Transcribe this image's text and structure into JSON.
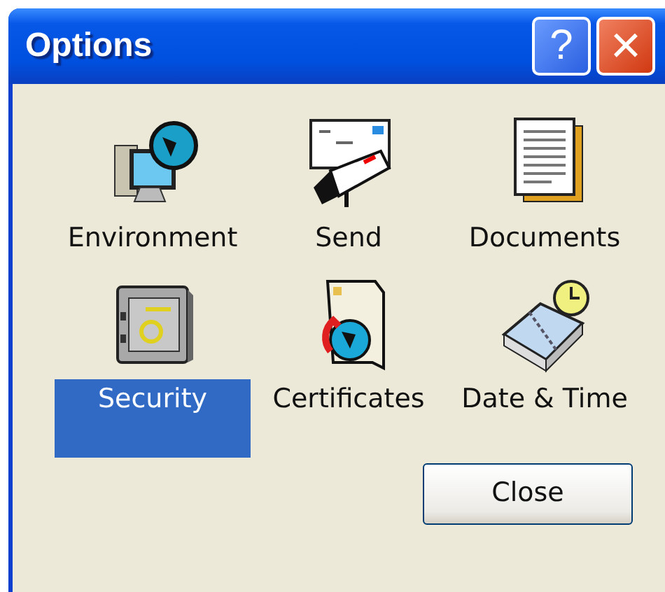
{
  "window": {
    "title": "Options",
    "help_button": "?",
    "close_button": "×"
  },
  "items": [
    {
      "kind": "environment",
      "label": "Environment",
      "selected": false
    },
    {
      "kind": "send",
      "label": "Send",
      "selected": false
    },
    {
      "kind": "documents",
      "label": "Documents",
      "selected": false
    },
    {
      "kind": "security",
      "label": "Security",
      "selected": true
    },
    {
      "kind": "certificates",
      "label": "Certificates",
      "selected": false
    },
    {
      "kind": "datetime",
      "label": "Date & Time",
      "selected": false
    }
  ],
  "buttons": [
    "Close"
  ]
}
